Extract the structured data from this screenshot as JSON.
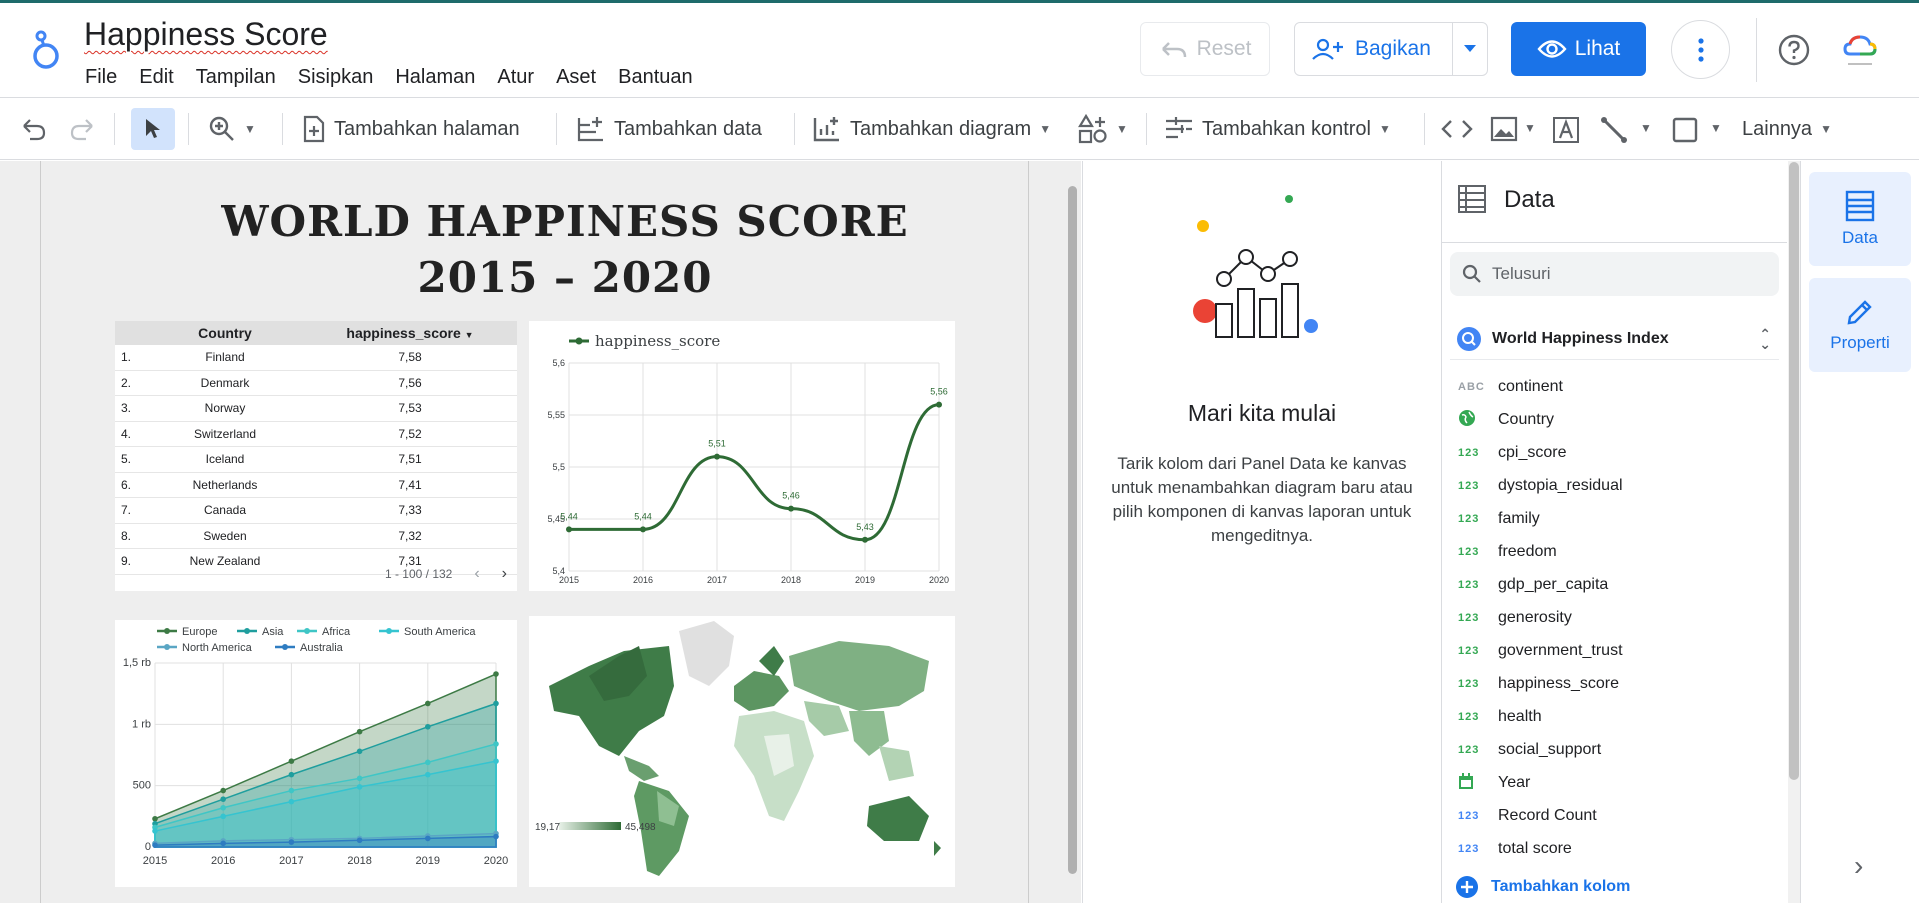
{
  "app": {
    "title": "Happiness Score",
    "menu": [
      "File",
      "Edit",
      "Tampilan",
      "Sisipkan",
      "Halaman",
      "Atur",
      "Aset",
      "Bantuan"
    ],
    "buttons": {
      "reset": "Reset",
      "share": "Bagikan",
      "view": "Lihat"
    }
  },
  "toolbar": {
    "add_page": "Tambahkan halaman",
    "add_data": "Tambahkan data",
    "add_chart": "Tambahkan diagram",
    "add_control": "Tambahkan kontrol",
    "more": "Lainnya"
  },
  "report": {
    "title_line1": "WORLD HAPPINESS SCORE",
    "title_line2": "2015 – 2020",
    "table": {
      "headers": [
        "Country",
        "happiness_score"
      ],
      "rows": [
        {
          "n": "1.",
          "country": "Finland",
          "score": "7,58"
        },
        {
          "n": "2.",
          "country": "Denmark",
          "score": "7,56"
        },
        {
          "n": "3.",
          "country": "Norway",
          "score": "7,53"
        },
        {
          "n": "4.",
          "country": "Switzerland",
          "score": "7,52"
        },
        {
          "n": "5.",
          "country": "Iceland",
          "score": "7,51"
        },
        {
          "n": "6.",
          "country": "Netherlands",
          "score": "7,41"
        },
        {
          "n": "7.",
          "country": "Canada",
          "score": "7,33"
        },
        {
          "n": "8.",
          "country": "Sweden",
          "score": "7,32"
        },
        {
          "n": "9.",
          "country": "New Zealand",
          "score": "7,31"
        }
      ],
      "pagination": "1 - 100 / 132"
    },
    "map_legend": {
      "min": "19,17",
      "max": "45,498"
    }
  },
  "chart_data": [
    {
      "type": "line",
      "legend": [
        "happiness_score"
      ],
      "x": [
        "2015",
        "2016",
        "2017",
        "2018",
        "2019",
        "2020"
      ],
      "series": [
        {
          "name": "happiness_score",
          "values": [
            5.44,
            5.44,
            5.51,
            5.46,
            5.43,
            5.56
          ],
          "labels": [
            "5,44",
            "5,44",
            "5,51",
            "5,46",
            "5,43",
            "5,56"
          ]
        }
      ],
      "yticks": [
        "5,4",
        "5,45",
        "5,5",
        "5,55",
        "5,6"
      ],
      "ylim": [
        5.4,
        5.6
      ],
      "color": "#2e6b35"
    },
    {
      "type": "area",
      "x": [
        "2015",
        "2016",
        "2017",
        "2018",
        "2019",
        "2020"
      ],
      "yticks": [
        "0",
        "500",
        "1 rb",
        "1,5 rb"
      ],
      "ylim": [
        0,
        1500
      ],
      "series": [
        {
          "name": "Europe",
          "color": "#3d7a45",
          "values": [
            230,
            460,
            700,
            940,
            1170,
            1410
          ]
        },
        {
          "name": "Asia",
          "color": "#1f9e9e",
          "values": [
            190,
            390,
            590,
            780,
            980,
            1170
          ]
        },
        {
          "name": "Africa",
          "color": "#3fc6c6",
          "values": [
            160,
            320,
            460,
            560,
            690,
            840
          ]
        },
        {
          "name": "South America",
          "color": "#35c4d0",
          "values": [
            130,
            250,
            370,
            490,
            590,
            700
          ]
        },
        {
          "name": "North America",
          "color": "#5aa6c4",
          "values": [
            30,
            50,
            60,
            70,
            90,
            110
          ]
        },
        {
          "name": "Australia",
          "color": "#2e7cc1",
          "values": [
            15,
            30,
            40,
            55,
            70,
            85
          ]
        }
      ]
    }
  ],
  "start": {
    "heading": "Mari kita mulai",
    "body": "Tarik kolom dari Panel Data ke kanvas untuk menambahkan diagram baru atau pilih komponen di kanvas laporan untuk mengeditnya."
  },
  "data_panel": {
    "title": "Data",
    "search_placeholder": "Telusuri",
    "source": "World Happiness Index",
    "fields": [
      {
        "type": "ABC",
        "name": "continent"
      },
      {
        "type": "geo",
        "name": "Country"
      },
      {
        "type": "123",
        "name": "cpi_score"
      },
      {
        "type": "123",
        "name": "dystopia_residual"
      },
      {
        "type": "123",
        "name": "family"
      },
      {
        "type": "123",
        "name": "freedom"
      },
      {
        "type": "123",
        "name": "gdp_per_capita"
      },
      {
        "type": "123",
        "name": "generosity"
      },
      {
        "type": "123",
        "name": "government_trust"
      },
      {
        "type": "123",
        "name": "happiness_score"
      },
      {
        "type": "123",
        "name": "health"
      },
      {
        "type": "123",
        "name": "social_support"
      },
      {
        "type": "date",
        "name": "Year"
      },
      {
        "type": "123b",
        "name": "Record Count"
      },
      {
        "type": "123b",
        "name": "total score"
      }
    ],
    "add_field": "Tambahkan kolom"
  },
  "rail": {
    "data": "Data",
    "properties": "Properti"
  }
}
